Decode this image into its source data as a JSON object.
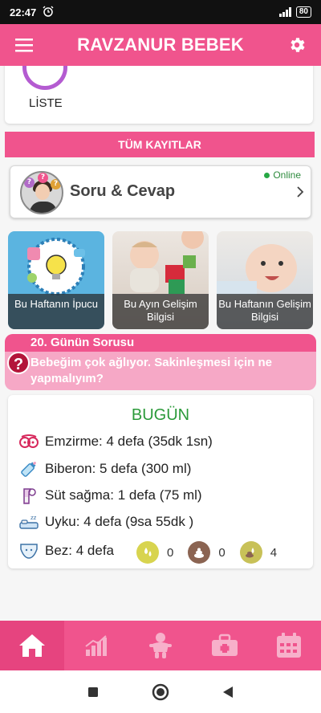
{
  "status_bar": {
    "time": "22:47",
    "battery": "80"
  },
  "app_bar": {
    "title": "RAVZANUR BEBEK"
  },
  "list_card": {
    "label": "LİSTE"
  },
  "all_records": {
    "label": "TÜM KAYITLAR"
  },
  "qa_card": {
    "title": "Soru & Cevap",
    "status": "Online",
    "status_color": "#27a844"
  },
  "tiles": [
    {
      "caption": "Bu Haftanın İpucu"
    },
    {
      "caption": "Bu Ayın Gelişim Bilgisi"
    },
    {
      "caption": "Bu Haftanın Gelişim Bilgisi"
    }
  ],
  "daily_question": {
    "title": "20. Günün Sorusu",
    "text": "Bebeğim çok ağlıyor. Sakinleşmesi için ne yapmalıyım?"
  },
  "today": {
    "heading": "BUGÜN",
    "rows": [
      {
        "icon": "breastfeeding-icon",
        "text": "Emzirme: 4 defa (35dk 1sn)"
      },
      {
        "icon": "baby-bottle-icon",
        "text": "Biberon: 5 defa (300 ml)"
      },
      {
        "icon": "breast-pump-icon",
        "text": "Süt sağma: 1 defa (75 ml)"
      },
      {
        "icon": "sleep-icon",
        "text": "Uyku: 4 defa (9sa 55dk )"
      },
      {
        "icon": "diaper-icon",
        "text": "Bez: 4 defa"
      }
    ],
    "diaper_counts": [
      {
        "icon": "wet-diaper-icon",
        "value": "0",
        "color": "#d8d44f"
      },
      {
        "icon": "dirty-diaper-icon",
        "value": "0",
        "color": "#8b6452"
      },
      {
        "icon": "mixed-diaper-icon",
        "value": "4",
        "color": "#c8c158"
      }
    ]
  },
  "bottom_nav": [
    {
      "icon": "home-icon",
      "active": true
    },
    {
      "icon": "growth-chart-icon",
      "active": false
    },
    {
      "icon": "baby-icon",
      "active": false
    },
    {
      "icon": "medical-kit-icon",
      "active": false
    },
    {
      "icon": "calendar-icon",
      "active": false
    }
  ],
  "colors": {
    "brand_pink": "#f0548d",
    "accent_green": "#2b9a3a"
  }
}
